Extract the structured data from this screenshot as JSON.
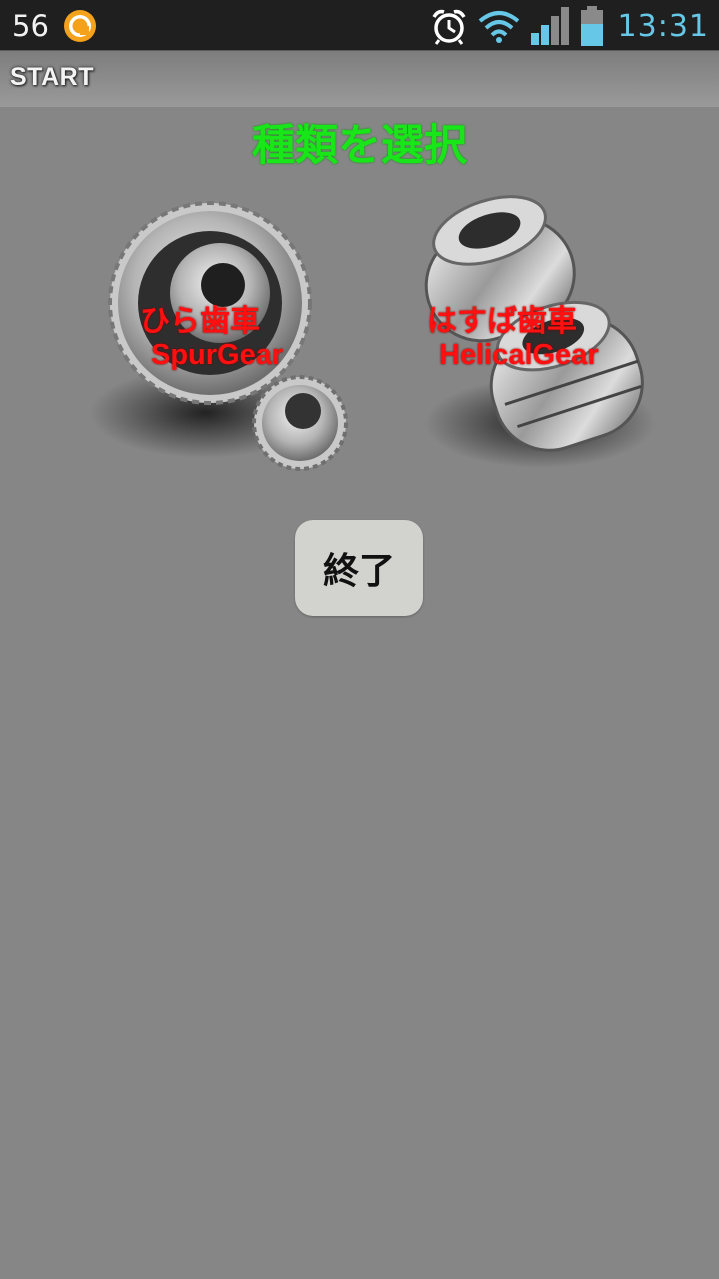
{
  "status_bar": {
    "left_number": "56",
    "app_icon": "orange-circle-app-icon",
    "icons": [
      "alarm-clock-icon",
      "wifi-icon",
      "signal-icon",
      "battery-icon"
    ],
    "time": "13:31",
    "time_color": "#66c7e6"
  },
  "title_bar": {
    "title": "START"
  },
  "main": {
    "heading": "種類を選択",
    "heading_color": "#19e619",
    "gears": [
      {
        "label_jp": "ひら歯車",
        "label_en": "SpurGear",
        "icon": "spur-gear-icon"
      },
      {
        "label_jp": "はすば歯車",
        "label_en": "HelicalGear",
        "icon": "helical-gear-icon"
      }
    ],
    "label_color": "#ff1010",
    "exit_button": {
      "label": "終了"
    }
  },
  "colors": {
    "background": "#868686",
    "status_bar": "#1f1f1f"
  }
}
